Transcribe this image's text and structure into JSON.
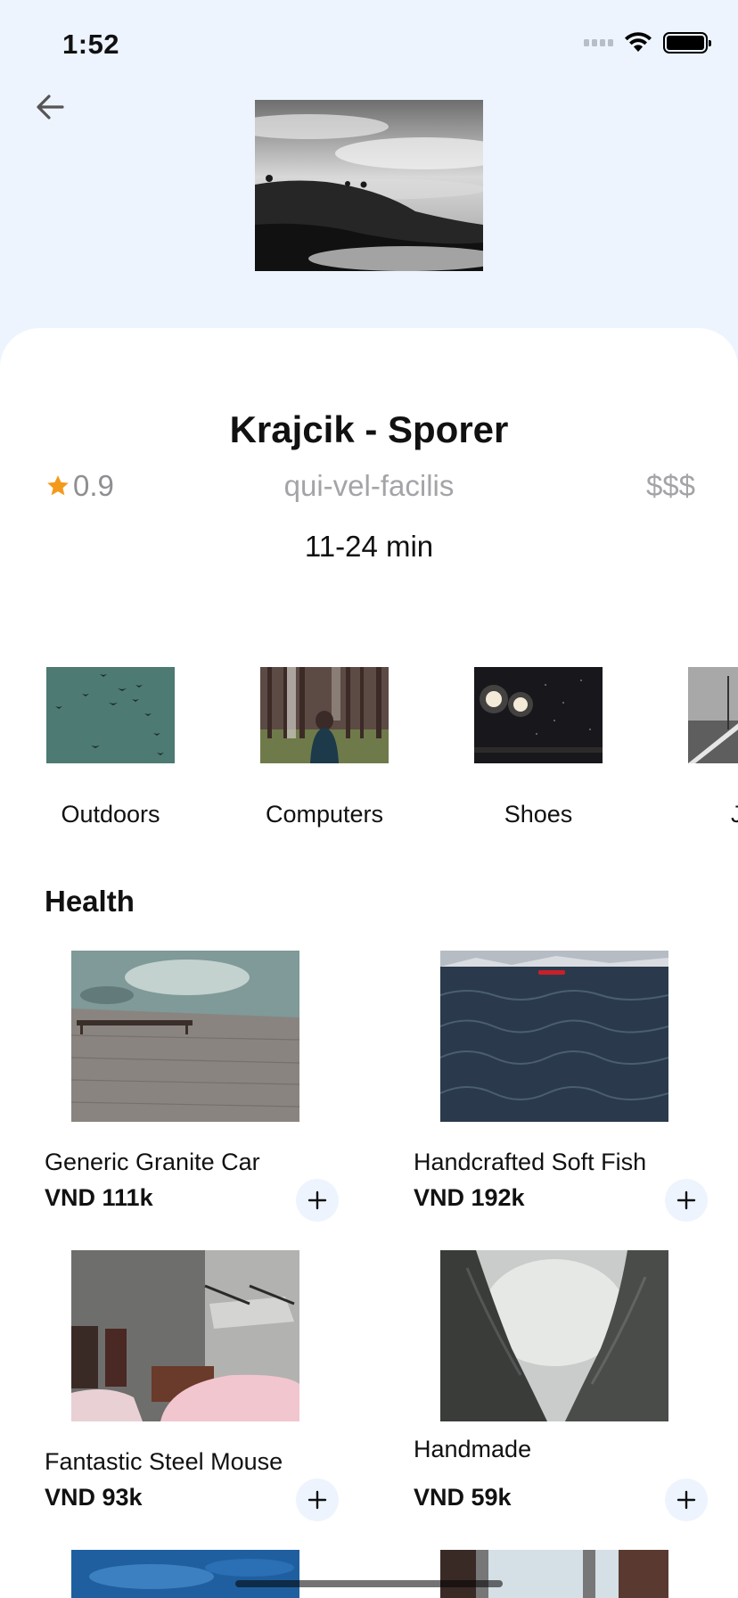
{
  "status_bar": {
    "time": "1:52"
  },
  "store": {
    "name": "Krajcik - Sporer",
    "rating": "0.9",
    "slug": "qui-vel-facilis",
    "price_level": "$$$",
    "eta": "11-24 min"
  },
  "categories": [
    {
      "label": "Outdoors"
    },
    {
      "label": "Computers"
    },
    {
      "label": "Shoes"
    },
    {
      "label": "Jew"
    }
  ],
  "section": {
    "title": "Health"
  },
  "products": [
    {
      "name": "Generic Granite Car",
      "price": "VND 111k"
    },
    {
      "name": "Handcrafted Soft Fish",
      "price": "VND 192k"
    },
    {
      "name": "Fantastic Steel Mouse",
      "price": "VND 93k"
    },
    {
      "name": "Handmade",
      "price": "VND 59k"
    }
  ],
  "colors": {
    "background": "#edf4fe",
    "star": "#f39a1c",
    "add_button_bg": "#eef4fd"
  }
}
